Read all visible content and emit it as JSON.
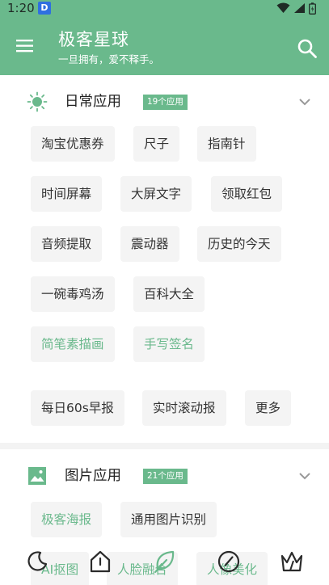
{
  "status_bar": {
    "time": "1:20",
    "app_icon_letter": "D"
  },
  "app_bar": {
    "title": "极客星球",
    "subtitle": "一旦拥有，爱不释手。",
    "menu_icon": "hamburger-menu-icon",
    "search_icon": "search-icon"
  },
  "sections": [
    {
      "title": "日常应用",
      "badge": "19个应用",
      "icon": "sun-icon",
      "chips": [
        "淘宝优惠券",
        "尺子",
        "指南针",
        "时间屏幕",
        "大屏文字",
        "领取红包",
        "音频提取",
        "震动器",
        "历史的今天",
        "一碗毒鸡汤",
        "百科大全",
        "简笔素描画",
        "手写签名",
        "每日60s早报",
        "实时滚动报",
        "更多"
      ]
    },
    {
      "title": "图片应用",
      "badge": "21个应用",
      "icon": "image-icon",
      "chips": [
        "极客海报",
        "通用图片识别",
        "AI抠图",
        "人脸融合",
        "人像美化"
      ]
    }
  ],
  "bottom_nav": {
    "items": [
      "moon-icon",
      "home-icon",
      "leaf-icon",
      "compass-icon",
      "crown-icon"
    ],
    "active_index": 2
  },
  "colors": {
    "accent": "#6ab98c",
    "chip_bg": "#f4f4f4",
    "text": "#222222"
  }
}
